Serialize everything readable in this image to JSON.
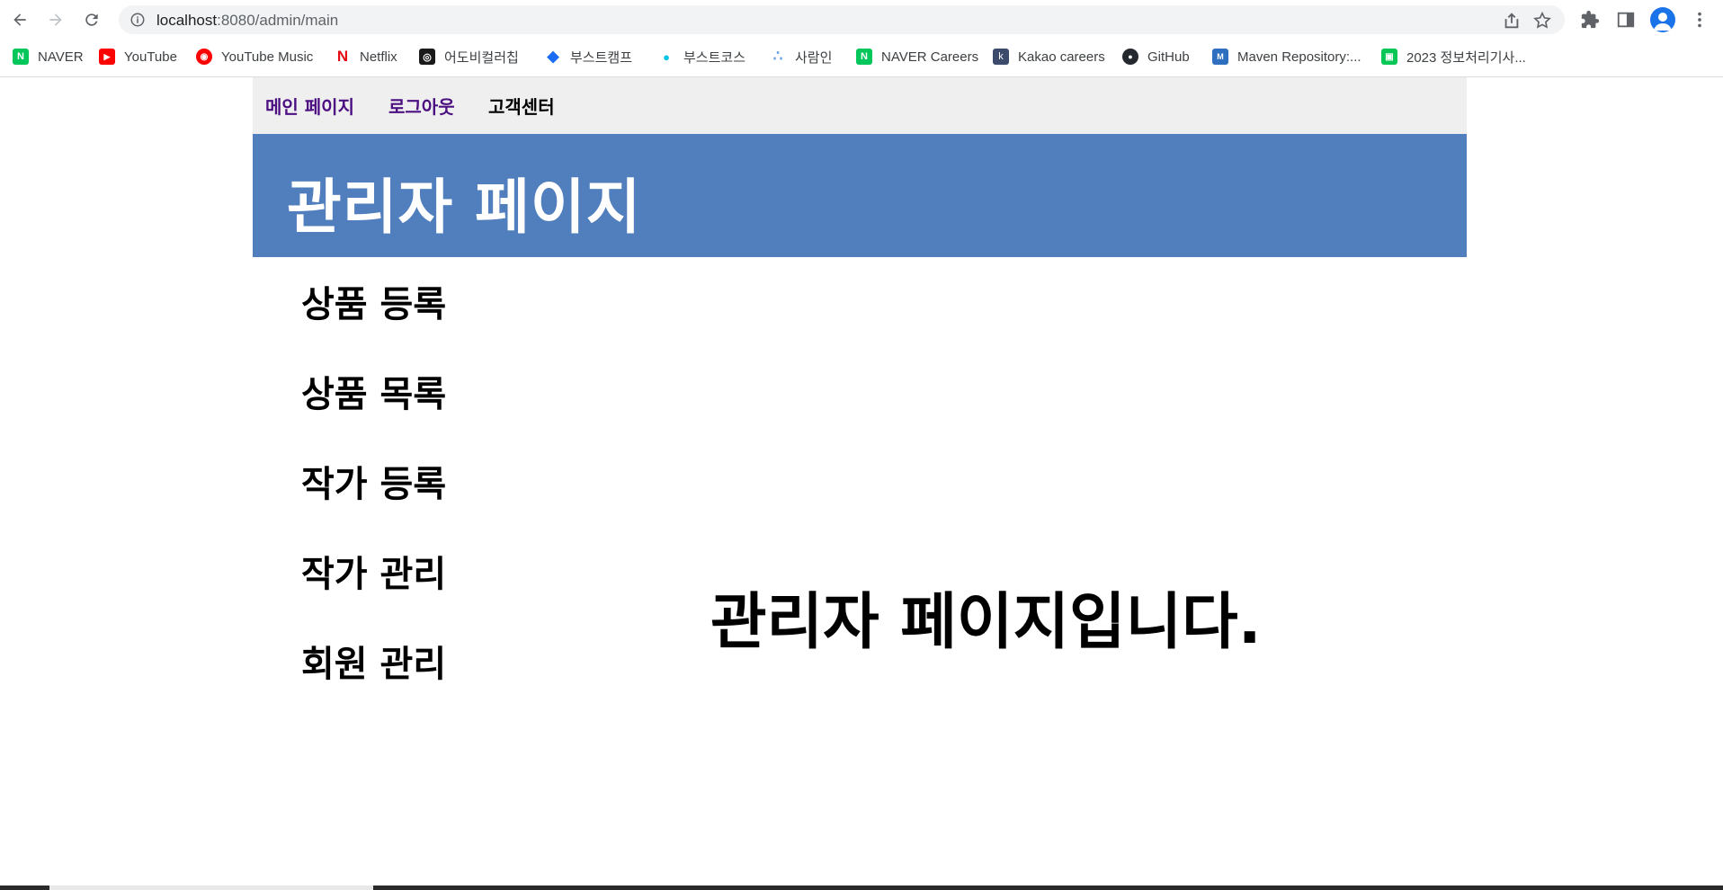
{
  "browser": {
    "url_host": "localhost",
    "url_path": ":8080/admin/main",
    "bookmarks": [
      {
        "label": "NAVER",
        "color": "#03c75a",
        "glyph": "N"
      },
      {
        "label": "YouTube",
        "color": "#ff0000",
        "glyph": "▶"
      },
      {
        "label": "YouTube Music",
        "color": "#ff0000",
        "glyph": "◉"
      },
      {
        "label": "Netflix",
        "color": "#e50914",
        "glyph": "N"
      },
      {
        "label": "어도비컬러칩",
        "color": "#1a1a1a",
        "glyph": "◎"
      },
      {
        "label": "부스트캠프",
        "color": "#1b6cf2",
        "glyph": "◆"
      },
      {
        "label": "부스트코스",
        "color": "#00c4e6",
        "glyph": "●"
      },
      {
        "label": "사람인",
        "color": "#6aa0e8",
        "glyph": "∴"
      },
      {
        "label": "NAVER Careers",
        "color": "#03c75a",
        "glyph": "N"
      },
      {
        "label": "Kakao careers",
        "color": "#3c4a6b",
        "glyph": "k"
      },
      {
        "label": "GitHub",
        "color": "#24292f",
        "glyph": "●"
      },
      {
        "label": "Maven Repository:...",
        "color": "#2f6fbf",
        "glyph": "M"
      },
      {
        "label": "2023 정보처리기사...",
        "color": "#06c755",
        "glyph": "▣"
      }
    ]
  },
  "topnav": {
    "main_page": "메인 페이지",
    "logout": "로그아웃",
    "customer_center": "고객센터"
  },
  "header": {
    "title": "관리자 페이지"
  },
  "sidemenu": {
    "items": [
      "상품 등록",
      "상품 목록",
      "작가 등록",
      "작가 관리",
      "회원 관리"
    ]
  },
  "main": {
    "welcome": "관리자 페이지입니다."
  },
  "colors": {
    "header_bg": "#517fbe",
    "nav_bg": "#efefef",
    "visited_link": "#4b0f82"
  }
}
